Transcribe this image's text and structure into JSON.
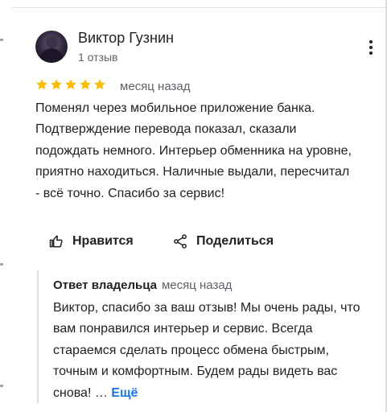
{
  "review": {
    "author_name": "Виктор Гузнин",
    "author_meta": "1 отзыв",
    "rating": 5,
    "rating_max": 5,
    "date": "месяц назад",
    "text": "Поменял через мобильное приложение банка. Подтверждение перевода показал, сказали подождать немного. Интерьер обменника на уровне, приятно находиться. Наличные выдали, пересчитал - всё точно. Спасибо за сервис!"
  },
  "actions": {
    "like_label": "Нравится",
    "share_label": "Поделиться"
  },
  "owner_reply": {
    "title": "Ответ владельца",
    "date": "месяц назад",
    "text": "Виктор, спасибо за ваш отзыв! Мы очень рады, что вам понравился интерьер и сервис. Всегда стараемся сделать процесс обмена быстрым, точным и комфортным. Будем рады видеть вас снова! … ",
    "more_label": "Ещё"
  },
  "colors": {
    "star": "#fbbc04",
    "link": "#1a73e8",
    "secondary_text": "#5f6368"
  }
}
